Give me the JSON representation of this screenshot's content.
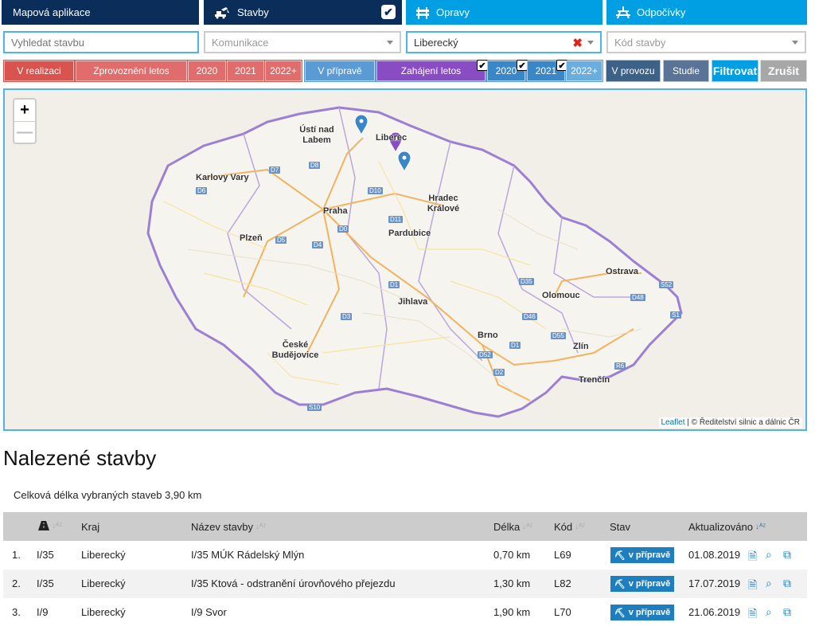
{
  "nav": {
    "tabs": [
      {
        "label": "Mapová aplikace"
      },
      {
        "label": "Stavby",
        "checked": true
      },
      {
        "label": "Opravy"
      },
      {
        "label": "Odpočívky"
      }
    ]
  },
  "filters": {
    "search_placeholder": "Vyhledat stavbu",
    "komunikace_placeholder": "Komunikace",
    "kraj_value": "Liberecký",
    "kod_placeholder": "Kód stavby"
  },
  "status_filters": {
    "v_realizaci": "V realizaci",
    "zprovozneni_letos": "Zprovoznění letos",
    "red_years": [
      "2020",
      "2021",
      "2022+"
    ],
    "v_priprave": "V přípravě",
    "zahajeni_letos": "Zahájení letos",
    "blue_years": [
      "2020",
      "2021",
      "2022+"
    ],
    "v_provozu": "V provozu",
    "studie": "Studie",
    "filtrovat": "Filtrovat",
    "zrusit": "Zrušit"
  },
  "map": {
    "zoom_in": "+",
    "zoom_out": "—",
    "attribution_link": "Leaflet",
    "attribution_text": " | © Ředitelství silnic a dálnic ČR",
    "cities": [
      "Ústí nad Labem",
      "Liberec",
      "Karlovy Vary",
      "Hradec Králové",
      "Praha",
      "Pardubice",
      "Plzeň",
      "Jihlava",
      "Olomouc",
      "Ostrava",
      "Brno",
      "Zlín",
      "České Budějovice",
      "Trenčín"
    ],
    "road_shields": [
      "D7",
      "D8",
      "D10",
      "D6",
      "D0",
      "D11",
      "D5",
      "D4",
      "D1",
      "D35",
      "D3",
      "D46",
      "D55",
      "D52",
      "D2",
      "D48",
      "S52",
      "S1",
      "R6",
      "S10",
      "D1"
    ],
    "colors": {
      "marker_blue": "#3a87c8",
      "marker_purple": "#8a4cc2",
      "border": "#9b7fd4"
    }
  },
  "results": {
    "title": "Nalezené stavby",
    "total": "Celková délka vybraných staveb 3,90 km",
    "headers": {
      "kraj": "Kraj",
      "nazev": "Název stavby",
      "delka": "Délka",
      "kod": "Kód",
      "stav": "Stav",
      "aktualizovano": "Aktualizováno"
    },
    "rows": [
      {
        "num": "1.",
        "road": "I/35",
        "kraj": "Liberecký",
        "nazev": "I/35 MÚK Rádelský Mlýn",
        "delka": "0,70 km",
        "kod": "L69",
        "stav": "v přípravě",
        "datum": "01.08.2019"
      },
      {
        "num": "2.",
        "road": "I/35",
        "kraj": "Liberecký",
        "nazev": "I/35 Ktová - odstranění úrovňového přejezdu",
        "delka": "1,30 km",
        "kod": "L82",
        "stav": "v přípravě",
        "datum": "17.07.2019"
      },
      {
        "num": "3.",
        "road": "I/9",
        "kraj": "Liberecký",
        "nazev": "I/9 Svor",
        "delka": "1,90 km",
        "kod": "L70",
        "stav": "v přípravě",
        "datum": "21.06.2019"
      }
    ]
  }
}
